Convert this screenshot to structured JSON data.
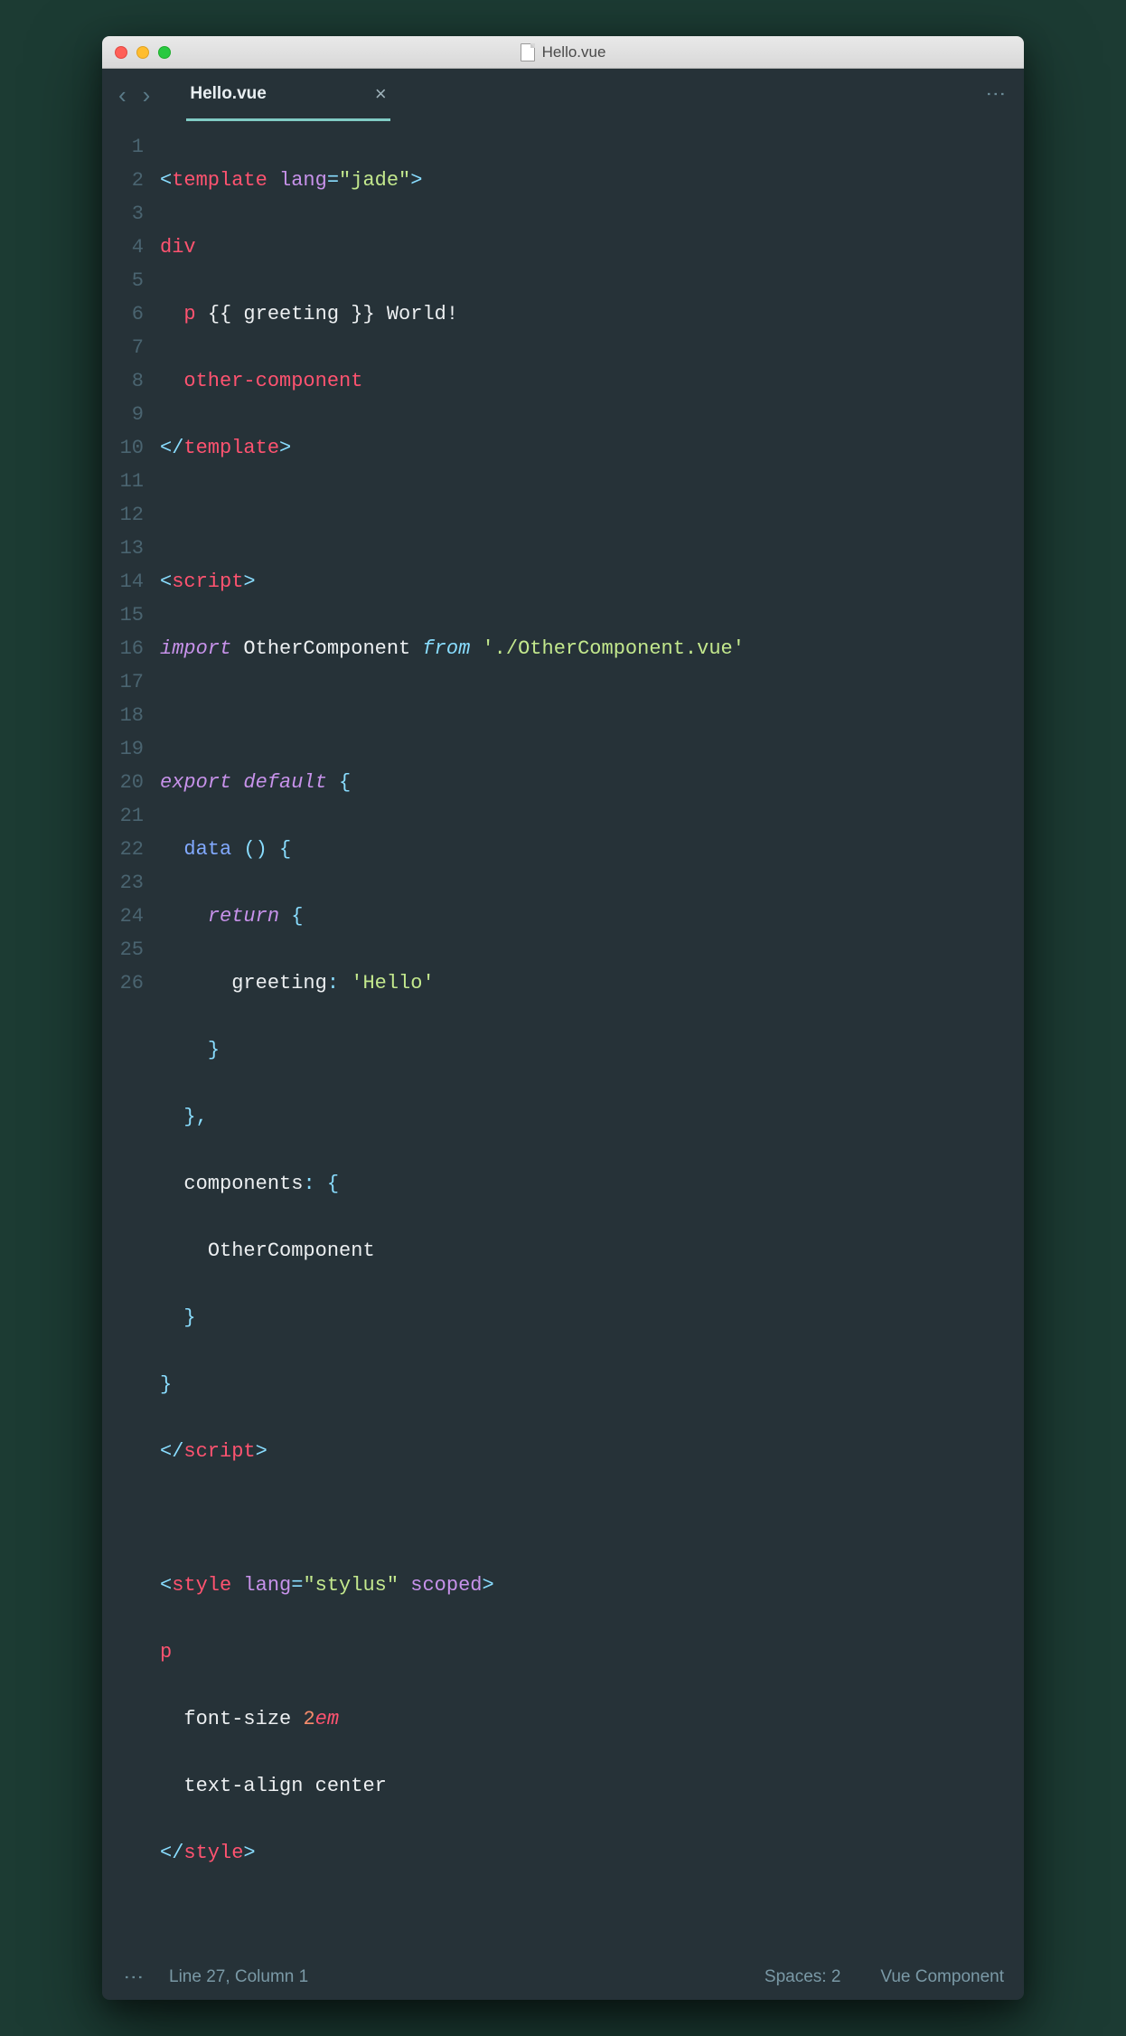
{
  "window": {
    "title": "Hello.vue"
  },
  "tab": {
    "name": "Hello.vue",
    "close": "×"
  },
  "gutter": [
    "1",
    "2",
    "3",
    "4",
    "5",
    "6",
    "7",
    "8",
    "9",
    "10",
    "11",
    "12",
    "13",
    "14",
    "15",
    "16",
    "17",
    "18",
    "19",
    "20",
    "21",
    "22",
    "23",
    "24",
    "25",
    "26"
  ],
  "code": {
    "l1": {
      "open": "<",
      "tag": "template",
      "sp": " ",
      "attr": "lang",
      "eq": "=",
      "val": "\"jade\"",
      "close": ">"
    },
    "l2": {
      "tag": "div"
    },
    "l3": {
      "indent": "  ",
      "tag": "p ",
      "text": "{{ greeting }} World!"
    },
    "l4": {
      "indent": "  ",
      "tag": "other-component"
    },
    "l5": {
      "open": "</",
      "tag": "template",
      "close": ">"
    },
    "l7": {
      "open": "<",
      "tag": "script",
      "close": ">"
    },
    "l8": {
      "kw": "import",
      "sp": " ",
      "id": "OtherComponent",
      "sp2": " ",
      "from": "from",
      "sp3": " ",
      "str": "'./OtherComponent.vue'"
    },
    "l10": {
      "kw": "export",
      "sp": " ",
      "kw2": "default",
      "sp2": " ",
      "brace": "{"
    },
    "l11": {
      "indent": "  ",
      "fn": "data ",
      "paren": "()",
      "sp": " ",
      "brace": "{"
    },
    "l12": {
      "indent": "    ",
      "kw": "return",
      "sp": " ",
      "brace": "{"
    },
    "l13": {
      "indent": "      ",
      "key": "greeting",
      "colon": ":",
      "sp": " ",
      "str": "'Hello'"
    },
    "l14": {
      "indent": "    ",
      "brace": "}"
    },
    "l15": {
      "indent": "  ",
      "brace": "}",
      "comma": ","
    },
    "l16": {
      "indent": "  ",
      "key": "components",
      "colon": ":",
      "sp": " ",
      "brace": "{"
    },
    "l17": {
      "indent": "    ",
      "id": "OtherComponent"
    },
    "l18": {
      "indent": "  ",
      "brace": "}"
    },
    "l19": {
      "brace": "}"
    },
    "l20": {
      "open": "</",
      "tag": "script",
      "close": ">"
    },
    "l22": {
      "open": "<",
      "tag": "style",
      "sp": " ",
      "attr": "lang",
      "eq": "=",
      "val": "\"stylus\"",
      "sp2": " ",
      "attr2": "scoped",
      "close": ">"
    },
    "l23": {
      "tag": "p"
    },
    "l24": {
      "indent": "  ",
      "prop": "font-size ",
      "num": "2",
      "unit": "em"
    },
    "l25": {
      "indent": "  ",
      "prop": "text-align ",
      "val": "center"
    },
    "l26": {
      "open": "</",
      "tag": "style",
      "close": ">"
    }
  },
  "status": {
    "cursor": "Line 27, Column 1",
    "spaces": "Spaces: 2",
    "syntax": "Vue Component"
  }
}
